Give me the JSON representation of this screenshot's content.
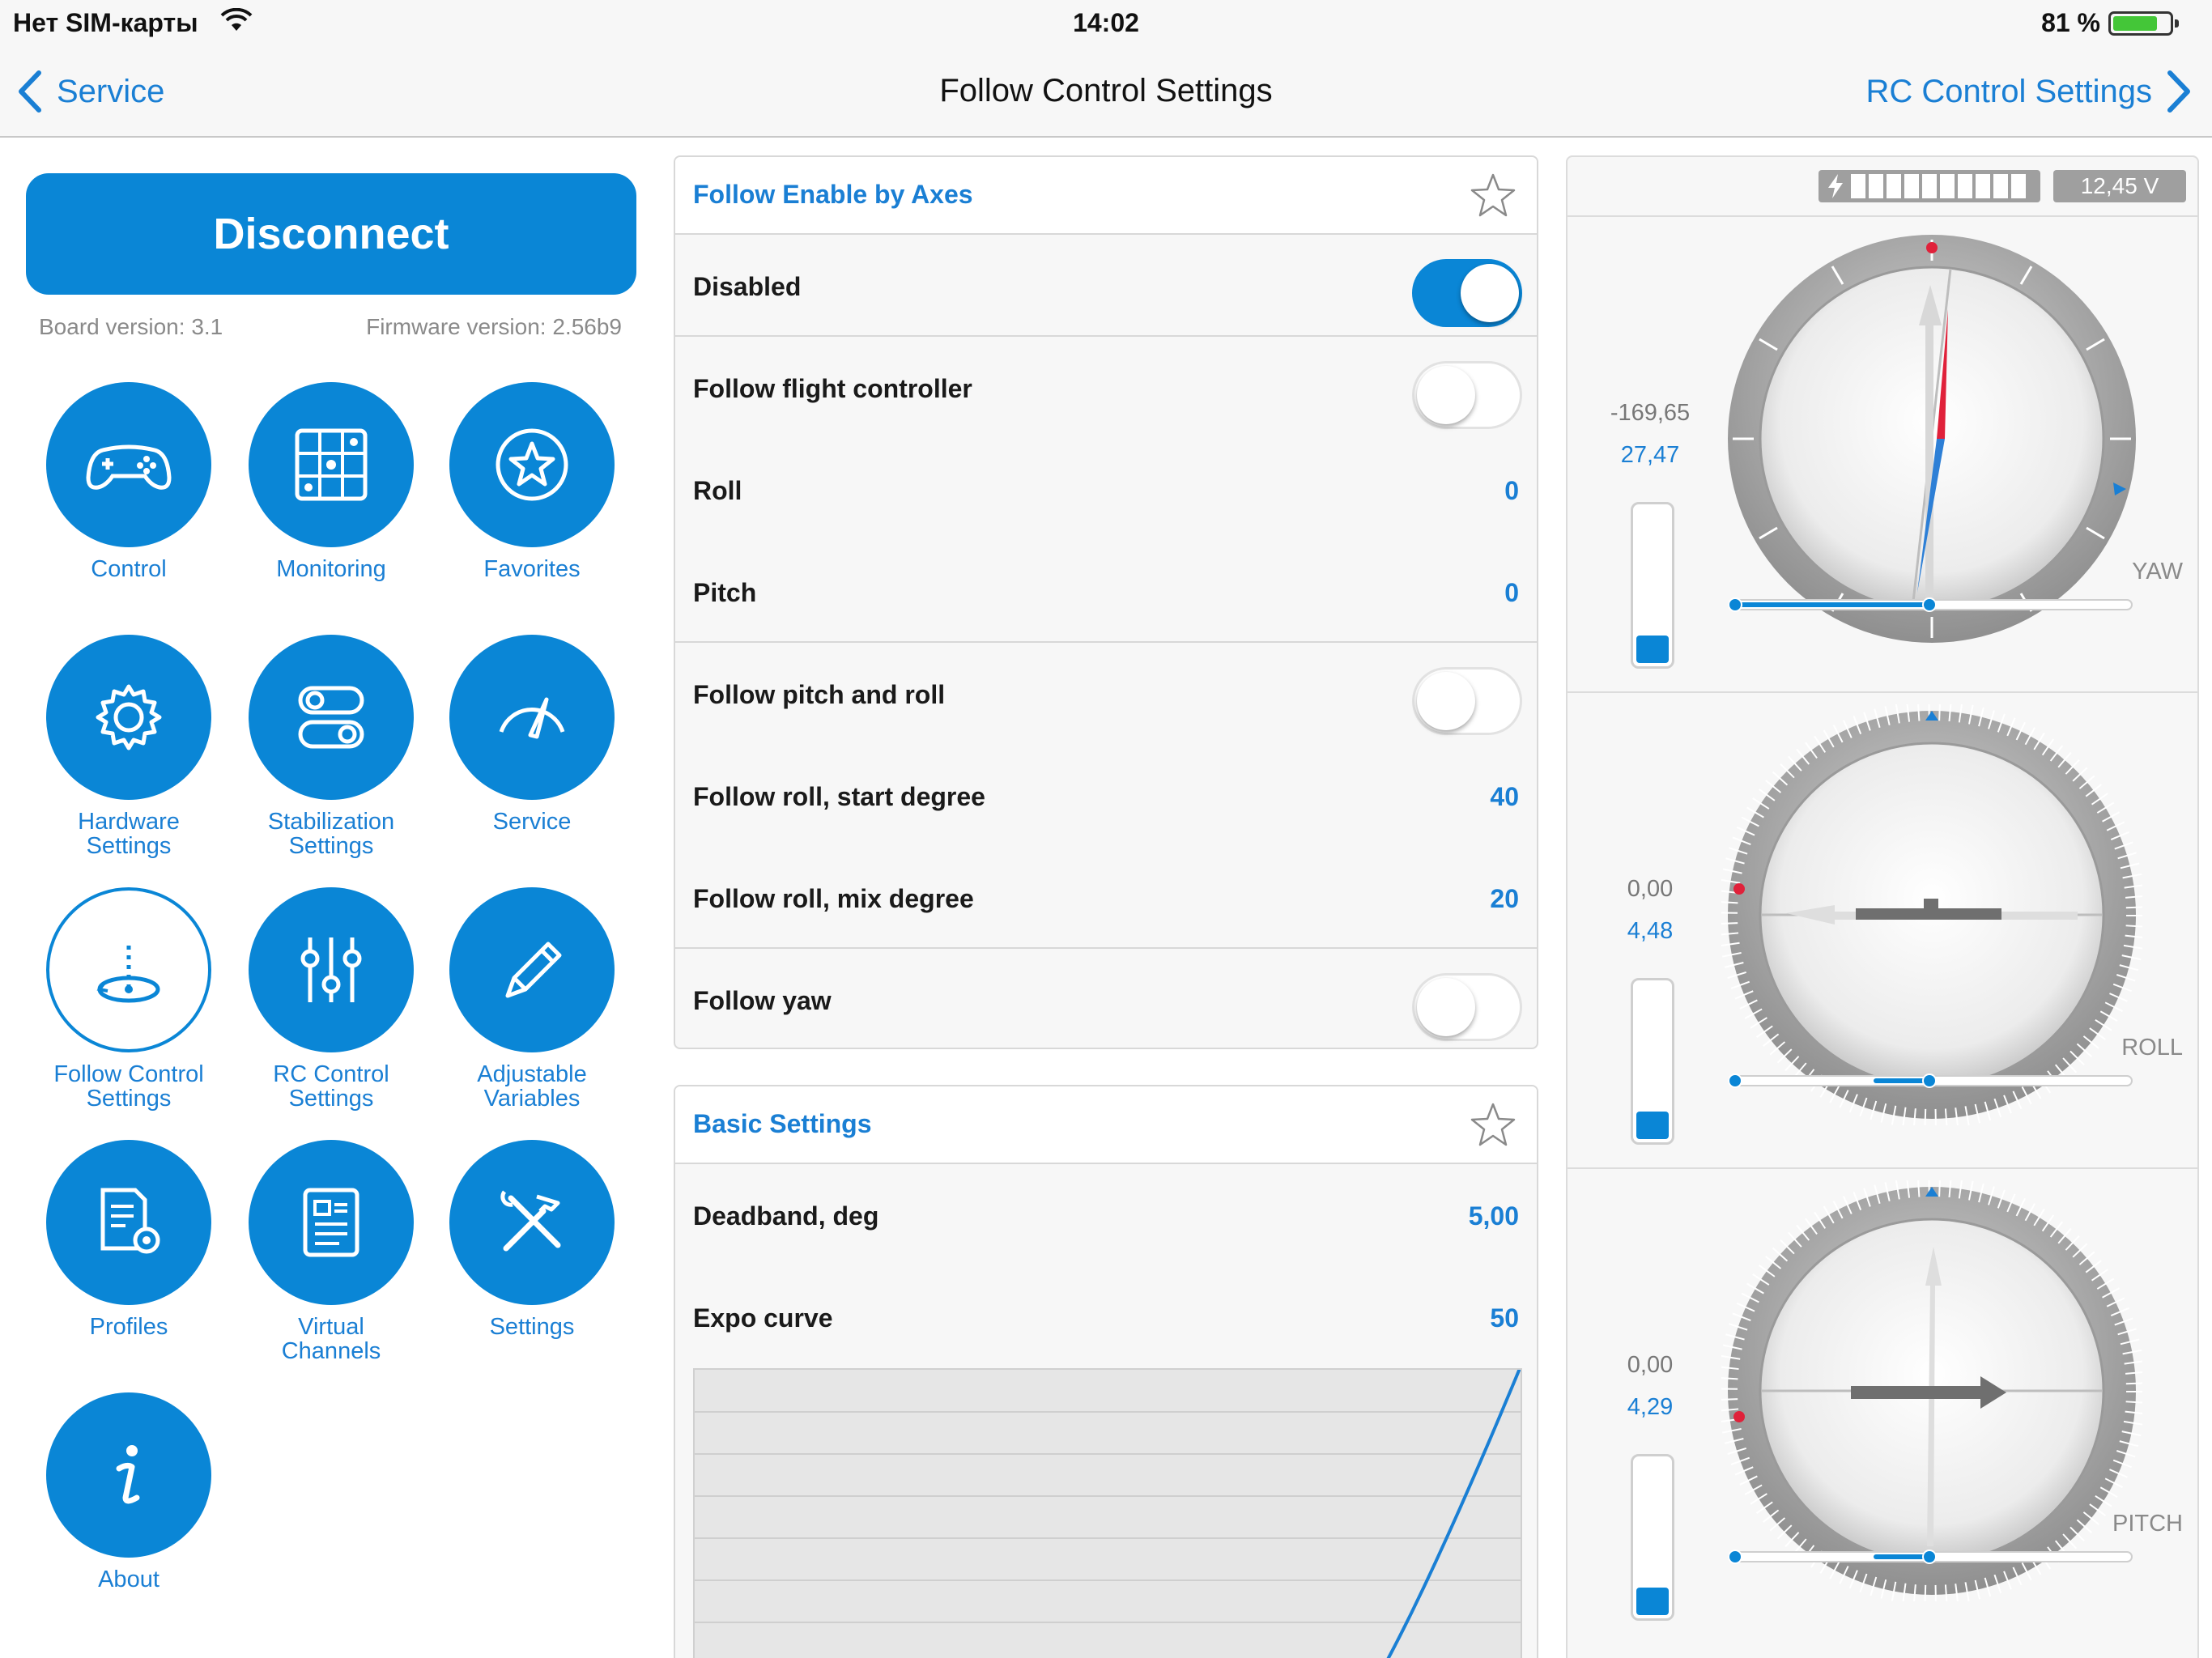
{
  "status_bar": {
    "carrier": "Нет SIM-карты",
    "time": "14:02",
    "battery_percent": "81 %",
    "battery_level": 0.81
  },
  "nav": {
    "back_label": "Service",
    "title": "Follow Control Settings",
    "forward_label": "RC Control Settings"
  },
  "sidebar": {
    "disconnect_label": "Disconnect",
    "board_version": "Board version: 3.1",
    "firmware_version": "Firmware version: 2.56b9",
    "tiles": [
      {
        "label": "Control",
        "icon": "gamepad-icon"
      },
      {
        "label": "Monitoring",
        "icon": "grid-icon"
      },
      {
        "label": "Favorites",
        "icon": "star-icon"
      },
      {
        "label": "Hardware Settings",
        "icon": "gear-icon"
      },
      {
        "label": "Stabilization Settings",
        "icon": "toggles-icon"
      },
      {
        "label": "Service",
        "icon": "gauge-icon"
      },
      {
        "label": "Follow Control Settings",
        "icon": "follow-icon",
        "active": true
      },
      {
        "label": "RC Control Settings",
        "icon": "sliders-icon"
      },
      {
        "label": "Adjustable Variables",
        "icon": "pencil-icon"
      },
      {
        "label": "Profiles",
        "icon": "document-gear-icon"
      },
      {
        "label": "Virtual Channels",
        "icon": "document-icon"
      },
      {
        "label": "Settings",
        "icon": "tools-icon"
      },
      {
        "label": "About",
        "icon": "info-icon"
      }
    ]
  },
  "follow_enable": {
    "title": "Follow Enable by Axes",
    "rows": [
      {
        "label": "Disabled",
        "type": "toggle",
        "on": true
      },
      {
        "label": "Follow flight controller",
        "type": "toggle",
        "on": false
      },
      {
        "label": "Roll",
        "type": "value",
        "value": "0"
      },
      {
        "label": "Pitch",
        "type": "value",
        "value": "0"
      },
      {
        "label": "Follow pitch and roll",
        "type": "toggle",
        "on": false
      },
      {
        "label": "Follow roll, start degree",
        "type": "value",
        "value": "40"
      },
      {
        "label": "Follow roll, mix degree",
        "type": "value",
        "value": "20"
      },
      {
        "label": "Follow yaw",
        "type": "toggle",
        "on": false
      }
    ]
  },
  "basic_settings": {
    "title": "Basic Settings",
    "rows": [
      {
        "label": "Deadband, deg",
        "value": "5,00"
      },
      {
        "label": "Expo curve",
        "value": "50"
      }
    ]
  },
  "monitor": {
    "voltage": "12,45 V",
    "battery_cells_total": 10,
    "gauges": [
      {
        "name": "YAW",
        "value1": "-169,65",
        "value2": "27,47",
        "vbar_level": 0.15,
        "slider": 0.5
      },
      {
        "name": "ROLL",
        "value1": "0,00",
        "value2": "4,48",
        "vbar_level": 0.15,
        "slider": 0.5
      },
      {
        "name": "PITCH",
        "value1": "0,00",
        "value2": "4,29",
        "vbar_level": 0.15,
        "slider": 0.5
      }
    ]
  },
  "colors": {
    "accent": "#0a86d6",
    "link": "#1a7fd4",
    "pointer_red": "#e0213a"
  }
}
